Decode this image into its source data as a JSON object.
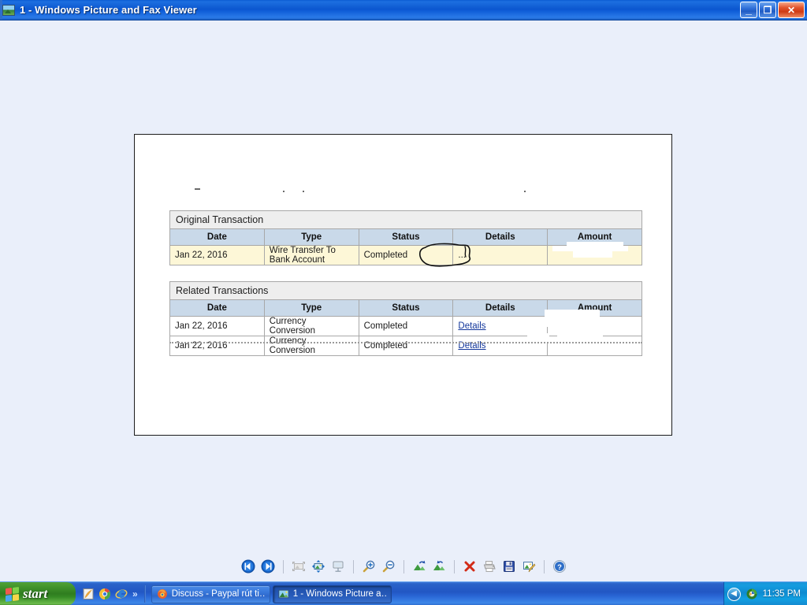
{
  "window": {
    "title": "1 - Windows Picture and Fax Viewer",
    "icon": "picture-file-icon",
    "minimize_glyph": "_",
    "restore_glyph": "❐",
    "close_glyph": "✕"
  },
  "document": {
    "erased_header_note": "",
    "original": {
      "caption": "Original Transaction",
      "columns": [
        "Date",
        "Type",
        "Status",
        "Details",
        "Amount"
      ],
      "rows": [
        {
          "date": "Jan 22, 2016",
          "type": "Wire Transfer To Bank Account",
          "status": "Completed",
          "details": "...",
          "amount": ""
        }
      ]
    },
    "related": {
      "caption": "Related Transactions",
      "columns": [
        "Date",
        "Type",
        "Status",
        "Details",
        "Amount"
      ],
      "rows": [
        {
          "date": "Jan 22, 2016",
          "type": "Currency Conversion",
          "status": "Completed",
          "details": "Details",
          "amount": ""
        },
        {
          "date": "Jan 22, 2016",
          "type": "Currency Conversion",
          "status": "Completed",
          "details": "Details",
          "amount": ""
        }
      ]
    },
    "annotation": {
      "type": "hand-drawn-ink-circle",
      "encircles": "Completed"
    }
  },
  "toolbar": {
    "items": [
      {
        "name": "previous-image-icon",
        "label": "Previous Image",
        "enabled": true
      },
      {
        "name": "next-image-icon",
        "label": "Next Image",
        "enabled": true
      },
      {
        "name": "best-fit-icon",
        "label": "Best Fit",
        "enabled": false
      },
      {
        "name": "actual-size-icon",
        "label": "Actual Size",
        "enabled": true
      },
      {
        "name": "slideshow-icon",
        "label": "Start Slide Show",
        "enabled": true
      },
      {
        "name": "zoom-in-icon",
        "label": "Zoom In",
        "enabled": true
      },
      {
        "name": "zoom-out-icon",
        "label": "Zoom Out",
        "enabled": true
      },
      {
        "name": "rotate-clockwise-icon",
        "label": "Rotate Clockwise",
        "enabled": true
      },
      {
        "name": "rotate-counterclockwise-icon",
        "label": "Rotate Counter Clockwise",
        "enabled": true
      },
      {
        "name": "delete-icon",
        "label": "Delete",
        "enabled": true
      },
      {
        "name": "print-icon",
        "label": "Print",
        "enabled": false
      },
      {
        "name": "save-as-icon",
        "label": "Copy To",
        "enabled": true
      },
      {
        "name": "edit-image-icon",
        "label": "Edit Picture",
        "enabled": true
      },
      {
        "name": "help-icon",
        "label": "Help",
        "enabled": true
      }
    ]
  },
  "taskbar": {
    "start_label": "start",
    "quicklaunch": [
      {
        "name": "notepad-icon",
        "label": "Notepad"
      },
      {
        "name": "chrome-icon",
        "label": "Google Chrome"
      },
      {
        "name": "internet-explorer-icon",
        "label": "Internet Explorer"
      }
    ],
    "quicklaunch_overflow": "»",
    "tasks": [
      {
        "icon": "firefox-icon",
        "label": "Discuss - Paypal rút ti…",
        "active": false
      },
      {
        "icon": "picture-file-icon",
        "label": "1 - Windows Picture a…",
        "active": true
      }
    ],
    "tray": {
      "expand_glyph": "◀",
      "icons": [
        {
          "name": "windows-update-icon",
          "label": "Windows Security Alerts"
        }
      ],
      "clock": "11:35 PM"
    }
  },
  "colors": {
    "desktop": "#eaeffa",
    "title_bar": "#0b56cf",
    "table_caption_bg": "#eeeeee",
    "table_header_bg": "#c9d9e9",
    "highlight_row_bg": "#fdf7d7",
    "link": "#12369b",
    "taskbar": "#2257c4",
    "start_green": "#2f7d20"
  }
}
